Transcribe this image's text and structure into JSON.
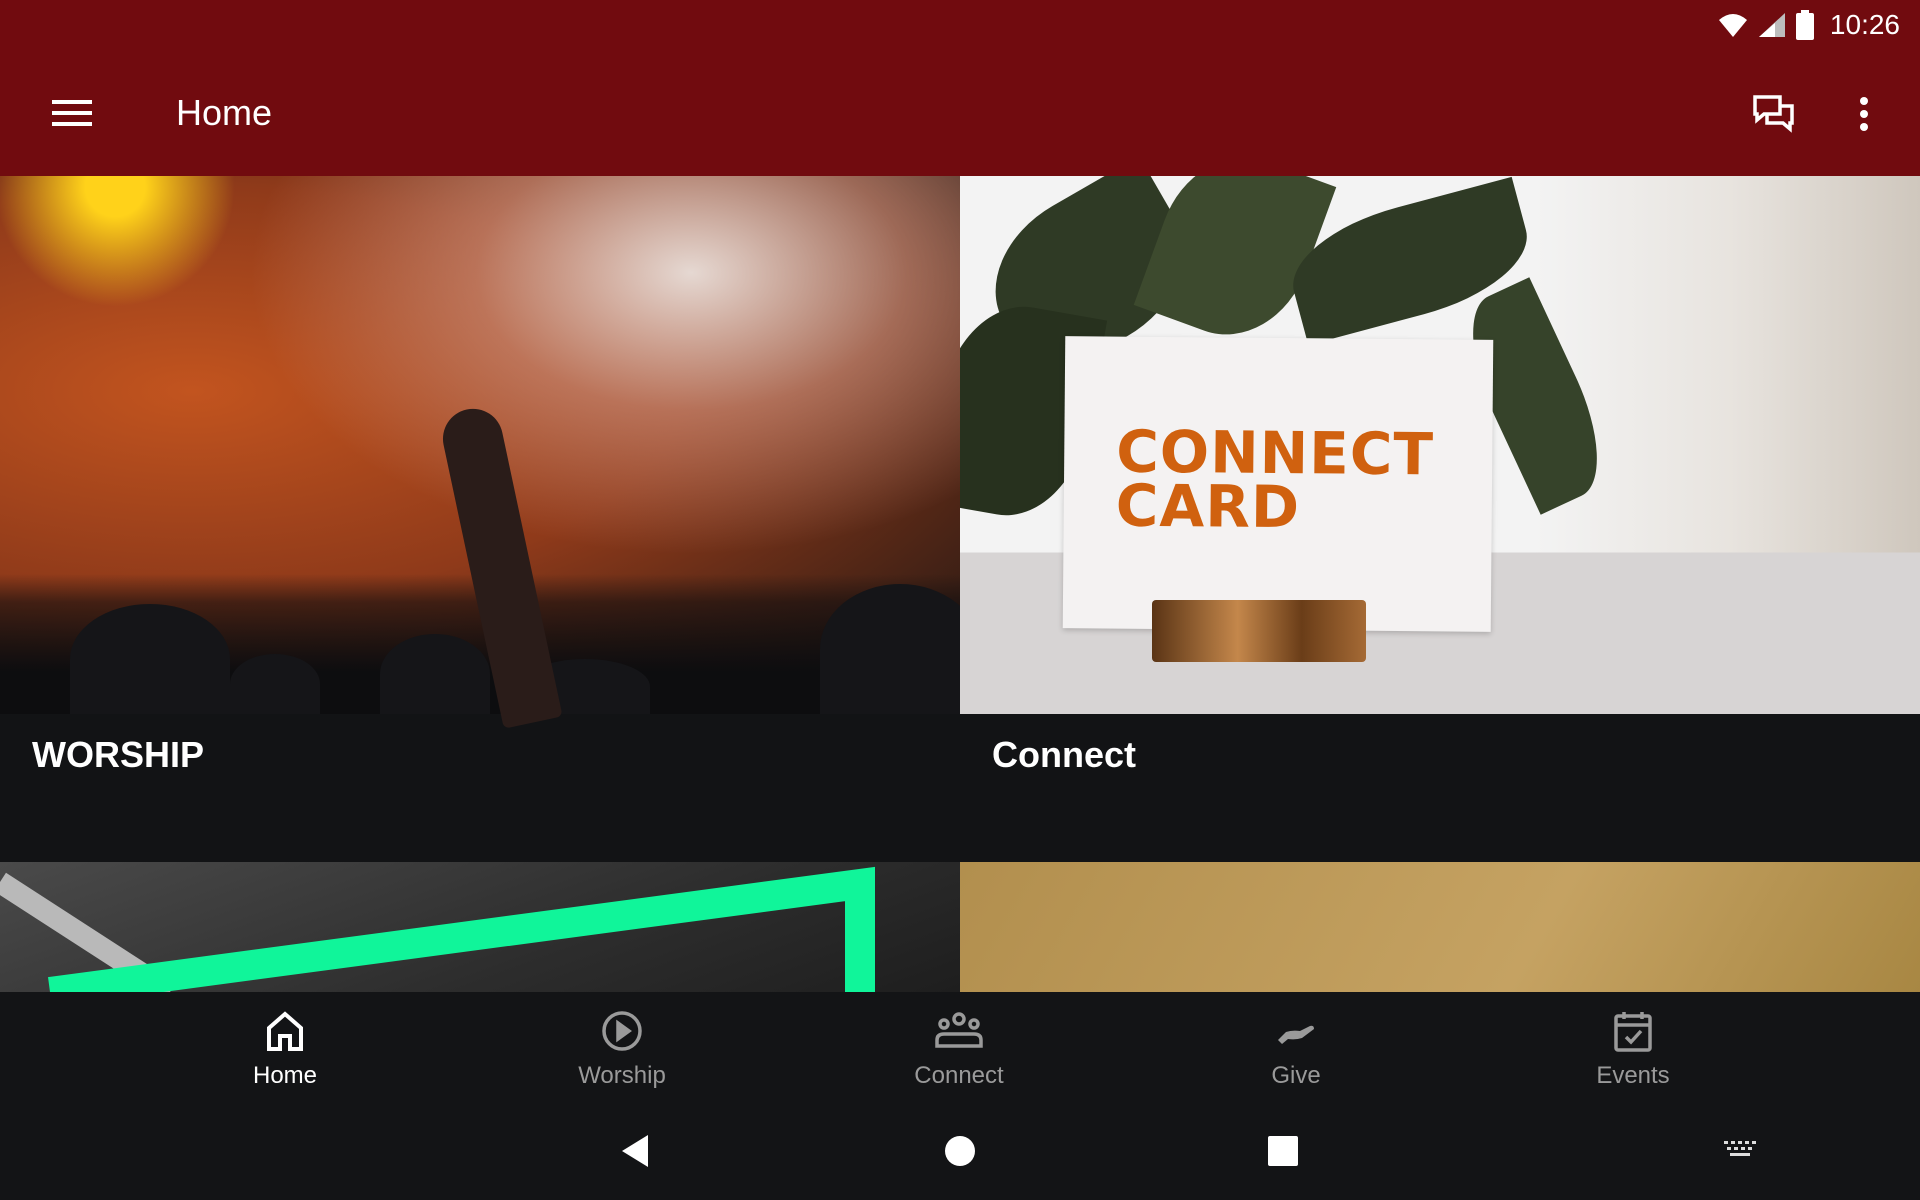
{
  "status_bar": {
    "time": "10:26",
    "icons": [
      "wifi-icon",
      "signal-icon",
      "battery-icon"
    ]
  },
  "app_bar": {
    "title": "Home",
    "icons": {
      "menu": "hamburger-menu-icon",
      "chat": "chat-icon",
      "more": "more-vert-icon"
    },
    "background": "#710b0f"
  },
  "cards": [
    {
      "label": "WORSHIP"
    },
    {
      "label": "Connect",
      "image_text": [
        "CONNECT",
        "CARD"
      ]
    },
    {
      "label": ""
    },
    {
      "label": ""
    }
  ],
  "bottom_nav": {
    "items": [
      {
        "label": "Home",
        "icon": "home-icon",
        "active": true
      },
      {
        "label": "Worship",
        "icon": "play-circle-icon",
        "active": false
      },
      {
        "label": "Connect",
        "icon": "group-icon",
        "active": false
      },
      {
        "label": "Give",
        "icon": "hand-giving-icon",
        "active": false
      },
      {
        "label": "Events",
        "icon": "calendar-check-icon",
        "active": false
      }
    ]
  },
  "system_nav": {
    "buttons": [
      "back-icon",
      "home-circle-icon",
      "recents-square-icon",
      "keyboard-icon"
    ]
  },
  "colors": {
    "accent_green": "#10f59a",
    "connect_orange": "#d0610f"
  }
}
